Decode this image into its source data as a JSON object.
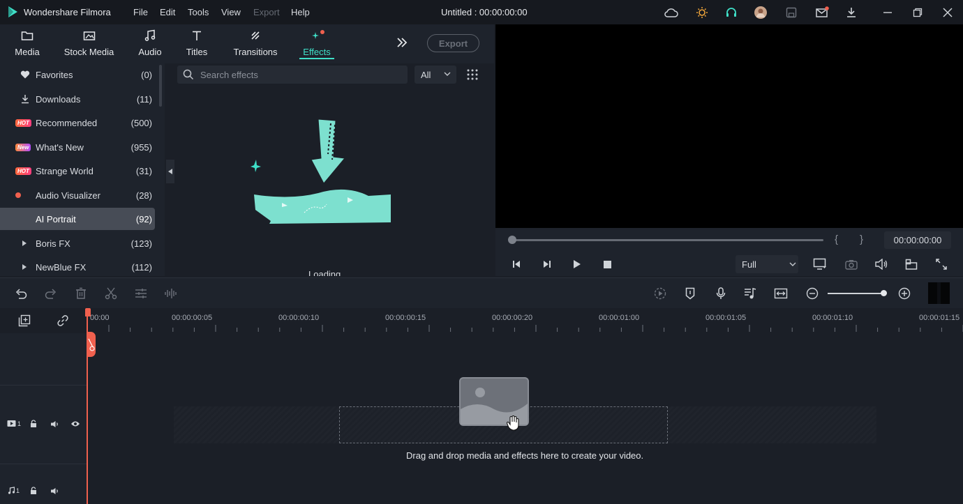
{
  "app": {
    "title": "Wondershare Filmora",
    "document_title": "Untitled : 00:00:00:00"
  },
  "menu": {
    "items": [
      "File",
      "Edit",
      "Tools",
      "View",
      "Export",
      "Help"
    ]
  },
  "tabs": [
    {
      "label": "Media"
    },
    {
      "label": "Stock Media"
    },
    {
      "label": "Audio"
    },
    {
      "label": "Titles"
    },
    {
      "label": "Transitions"
    },
    {
      "label": "Effects"
    }
  ],
  "tabs_export_label": "Export",
  "categories": [
    {
      "label": "Favorites",
      "count": "(0)",
      "icon": "heart-icon"
    },
    {
      "label": "Downloads",
      "count": "(11)",
      "icon": "download-icon"
    },
    {
      "label": "Recommended",
      "count": "(500)",
      "badge": "HOT"
    },
    {
      "label": "What's New",
      "count": "(955)",
      "badge": "New"
    },
    {
      "label": "Strange World",
      "count": "(31)",
      "badge": "HOT"
    },
    {
      "label": "Audio Visualizer",
      "count": "(28)",
      "icon": "red-dot"
    },
    {
      "label": "AI Portrait",
      "count": "(92)"
    },
    {
      "label": "Boris FX",
      "count": "(123)",
      "icon": "expand-triangle"
    },
    {
      "label": "NewBlue FX",
      "count": "(112)",
      "icon": "expand-triangle"
    }
  ],
  "effects": {
    "search_placeholder": "Search effects",
    "filter": "All",
    "loading": "Loading"
  },
  "preview": {
    "timecode": "00:00:00:00",
    "quality": "Full",
    "brace_open": "{",
    "brace_close": "}"
  },
  "ruler": {
    "labels": [
      "00:00",
      "00:00:00:05",
      "00:00:00:10",
      "00:00:00:15",
      "00:00:00:20",
      "00:00:01:00",
      "00:00:01:05",
      "00:00:01:10",
      "00:00:01:15"
    ]
  },
  "tracks": {
    "video_track": "1",
    "audio_track": "1",
    "drop_hint": "Drag and drop media and effects here to create your video."
  },
  "colors": {
    "accent": "#3fe0c8",
    "playhead": "#f0604e",
    "background": "#1b1f27"
  }
}
